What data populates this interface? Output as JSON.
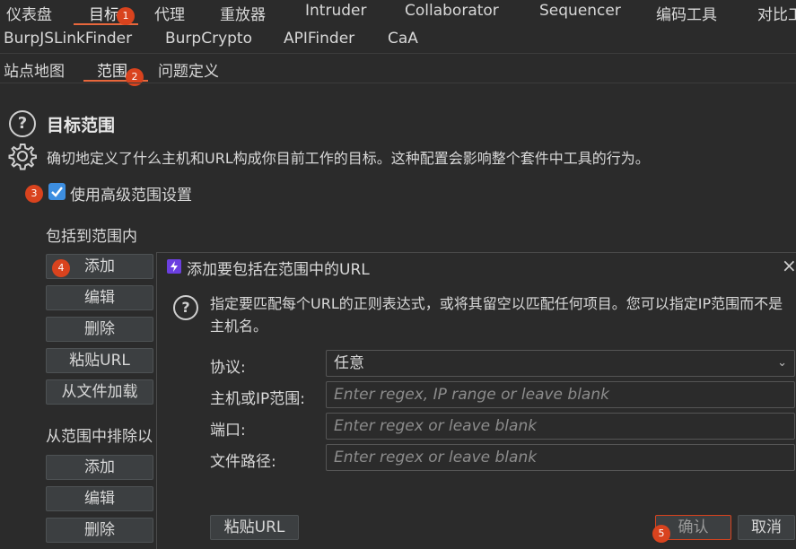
{
  "main_tabs_row1": [
    "仪表盘",
    "目标",
    "代理",
    "重放器",
    "Intruder",
    "Collaborator",
    "Sequencer",
    "编码工具",
    "对比工"
  ],
  "main_tabs_row2": [
    "BurpJSLinkFinder",
    "BurpCrypto",
    "APIFinder",
    "CaA"
  ],
  "sub_tabs": [
    "站点地图",
    "范围",
    "问题定义"
  ],
  "badges": [
    "1",
    "2",
    "3",
    "4",
    "5"
  ],
  "scope": {
    "title": "目标范围",
    "description": "确切地定义了什么主机和URL构成你目前工作的目标。这种配置会影响整个套件中工具的行为。",
    "advanced_checkbox_label": "使用高级范围设置",
    "advanced_checked": true,
    "include_heading": "包括到范围内",
    "include_buttons": [
      "添加",
      "编辑",
      "删除",
      "粘贴URL",
      "从文件加载"
    ],
    "exclude_heading": "从范围中排除以",
    "exclude_buttons": [
      "添加",
      "编辑",
      "删除"
    ]
  },
  "dialog": {
    "title": "添加要包括在范围中的URL",
    "info": "指定要匹配每个URL的正则表达式，或将其留空以匹配任何项目。您可以指定IP范围而不是主机名。",
    "protocol_label": "协议:",
    "protocol_value": "任意",
    "host_label": "主机或IP范围:",
    "host_placeholder": "Enter regex, IP range or leave blank",
    "port_label": "端口:",
    "port_placeholder": "Enter regex or leave blank",
    "path_label": "文件路径:",
    "path_placeholder": "Enter regex or leave blank",
    "paste_url_button": "粘贴URL",
    "ok_button": "确认",
    "cancel_button": "取消"
  },
  "colors": {
    "background": "#2b2b2b",
    "accent": "#e8673c",
    "badge": "#d9431e",
    "checkbox": "#3d8ee0"
  }
}
